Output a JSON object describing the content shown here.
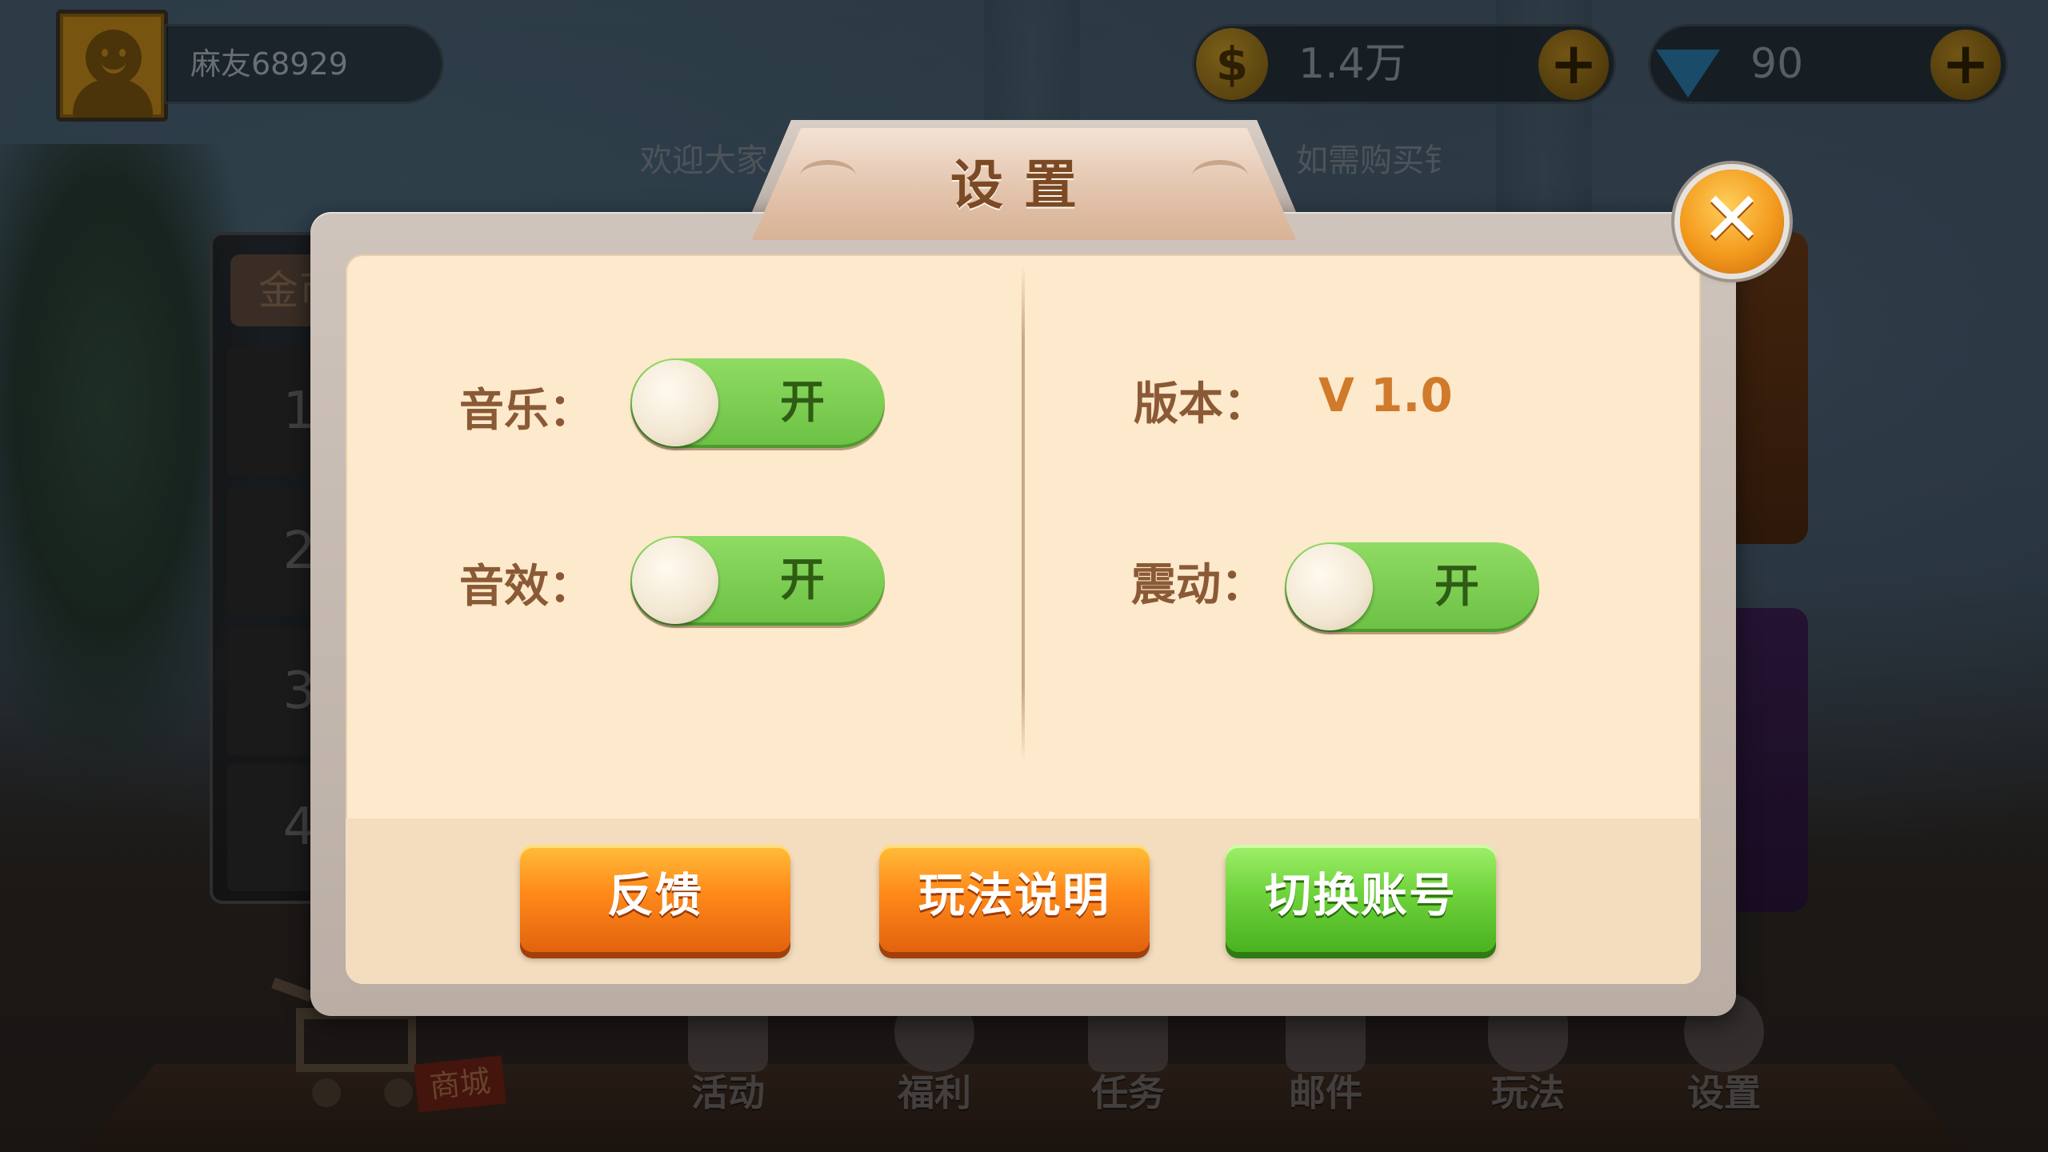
{
  "player": {
    "name": "麻友68929"
  },
  "resources": {
    "gold": {
      "icon": "coin-icon",
      "value": "1.4万"
    },
    "diamond": {
      "icon": "diamond-icon",
      "value": "90"
    }
  },
  "marquee": {
    "left": "欢迎大家",
    "right": "圈。如需购买钅"
  },
  "background": {
    "rank_tab": "金币",
    "rank_rows": [
      "1",
      "2",
      "3",
      "4"
    ],
    "shop_tag": "商城"
  },
  "bottom_nav": [
    {
      "label": "活动",
      "icon": "gift-icon"
    },
    {
      "label": "福利",
      "icon": "money-bag-icon"
    },
    {
      "label": "任务",
      "icon": "clipboard-check-icon"
    },
    {
      "label": "邮件",
      "icon": "mail-icon"
    },
    {
      "label": "玩法",
      "icon": "gamepad-icon"
    },
    {
      "label": "设置",
      "icon": "gear-icon"
    }
  ],
  "settings_dialog": {
    "title": "设置",
    "music": {
      "label": "音乐：",
      "state": "开"
    },
    "sfx": {
      "label": "音效：",
      "state": "开"
    },
    "version": {
      "label": "版本：",
      "value": "V 1.0"
    },
    "vibration": {
      "label": "震动：",
      "state": "开"
    },
    "buttons": {
      "feedback": "反馈",
      "rules": "玩法说明",
      "switch_account": "切换账号"
    },
    "close_icon": "close-icon"
  },
  "colors": {
    "toggle_on": "#6cc144",
    "panel_bg": "#fde9cb",
    "label_brown": "#8a5a36",
    "version_orange": "#d07a2c",
    "button_orange": "#ff8a1a",
    "button_green": "#6fd33c"
  }
}
